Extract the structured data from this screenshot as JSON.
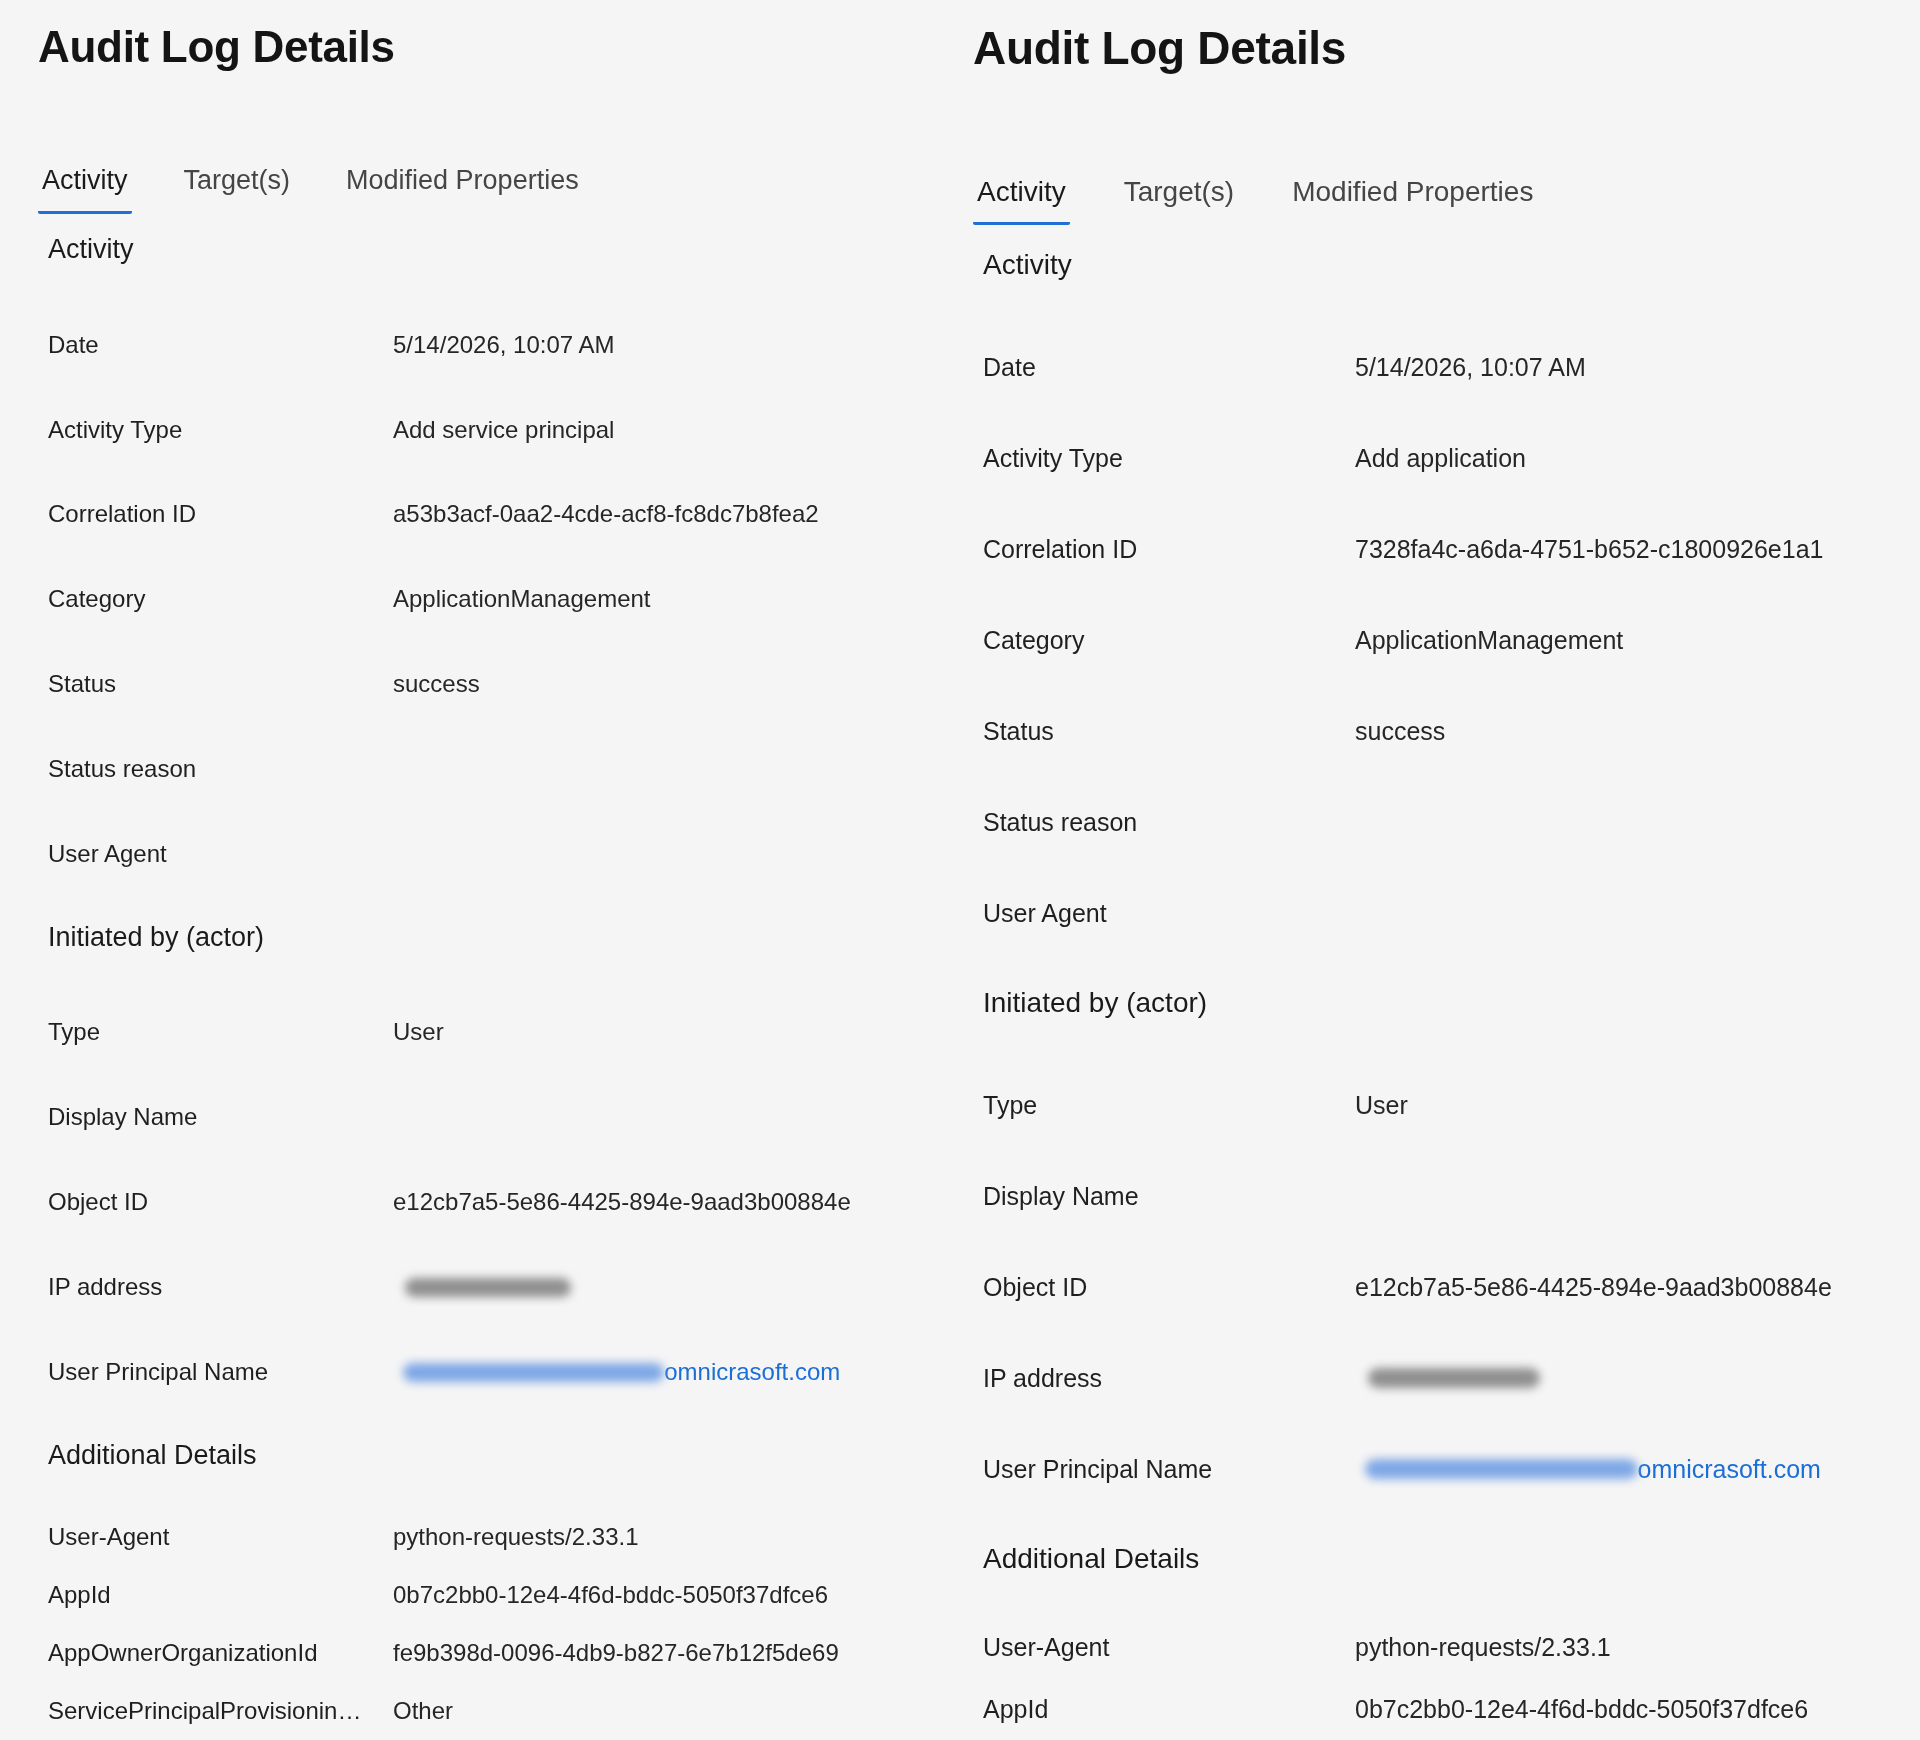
{
  "panels": [
    {
      "title": "Audit Log Details",
      "tabs": [
        {
          "label": "Activity",
          "selected": true
        },
        {
          "label": "Target(s)",
          "selected": false
        },
        {
          "label": "Modified Properties",
          "selected": false
        }
      ],
      "rows": [
        {
          "kind": "heading",
          "label": "Activity"
        },
        {
          "kind": "field",
          "label": "Date",
          "value": "5/14/2026, 10:07 AM"
        },
        {
          "kind": "field",
          "label": "Activity Type",
          "value": "Add service principal"
        },
        {
          "kind": "field",
          "label": "Correlation ID",
          "value": "a53b3acf-0aa2-4cde-acf8-fc8dc7b8fea2"
        },
        {
          "kind": "field",
          "label": "Category",
          "value": "ApplicationManagement"
        },
        {
          "kind": "field",
          "label": "Status",
          "value": "success"
        },
        {
          "kind": "field",
          "label": "Status reason"
        },
        {
          "kind": "field",
          "label": "User Agent"
        },
        {
          "kind": "heading",
          "label": "Initiated by (actor)"
        },
        {
          "kind": "field",
          "label": "Type",
          "value": "User"
        },
        {
          "kind": "field",
          "label": "Display Name"
        },
        {
          "kind": "field",
          "label": "Object ID",
          "value": "e12cb7a5-5e86-4425-894e-9aad3b00884e"
        },
        {
          "kind": "field",
          "label": "IP address",
          "blurred": true
        },
        {
          "kind": "link",
          "label": "User Principal Name",
          "value": "omnicrasoft.com",
          "blurred": true
        },
        {
          "kind": "heading",
          "label": "Additional Details"
        },
        {
          "kind": "detail",
          "label": "User-Agent",
          "value": "python-requests/2.33.1"
        },
        {
          "kind": "detail",
          "label": "AppId",
          "value": "0b7c2bb0-12e4-4f6d-bddc-5050f37dfce6"
        },
        {
          "kind": "detail",
          "label": "AppOwnerOrganizationId",
          "value": "fe9b398d-0096-4db9-b827-6e7b12f5de69"
        },
        {
          "kind": "detail",
          "label": "ServicePrincipalProvisionin…",
          "value": "Other"
        }
      ]
    },
    {
      "title": "Audit Log Details",
      "tabs": [
        {
          "label": "Activity",
          "selected": true
        },
        {
          "label": "Target(s)",
          "selected": false
        },
        {
          "label": "Modified Properties",
          "selected": false
        }
      ],
      "rows": [
        {
          "kind": "heading",
          "label": "Activity"
        },
        {
          "kind": "field",
          "label": "Date",
          "value": "5/14/2026, 10:07 AM"
        },
        {
          "kind": "field",
          "label": "Activity Type",
          "value": "Add application"
        },
        {
          "kind": "field",
          "label": "Correlation ID",
          "value": "7328fa4c-a6da-4751-b652-c1800926e1a1"
        },
        {
          "kind": "field",
          "label": "Category",
          "value": "ApplicationManagement"
        },
        {
          "kind": "field",
          "label": "Status",
          "value": "success"
        },
        {
          "kind": "field",
          "label": "Status reason"
        },
        {
          "kind": "field",
          "label": "User Agent"
        },
        {
          "kind": "heading",
          "label": "Initiated by (actor)"
        },
        {
          "kind": "field",
          "label": "Type",
          "value": "User"
        },
        {
          "kind": "field",
          "label": "Display Name"
        },
        {
          "kind": "field",
          "label": "Object ID",
          "value": "e12cb7a5-5e86-4425-894e-9aad3b00884e"
        },
        {
          "kind": "field",
          "label": "IP address",
          "blurred": true
        },
        {
          "kind": "link",
          "label": "User Principal Name",
          "value": "omnicrasoft.com",
          "blurred": true
        },
        {
          "kind": "heading",
          "label": "Additional Details"
        },
        {
          "kind": "detail",
          "label": "User-Agent",
          "value": "python-requests/2.33.1"
        },
        {
          "kind": "detail",
          "label": "AppId",
          "value": "0b7c2bb0-12e4-4f6d-bddc-5050f37dfce6"
        }
      ]
    }
  ]
}
